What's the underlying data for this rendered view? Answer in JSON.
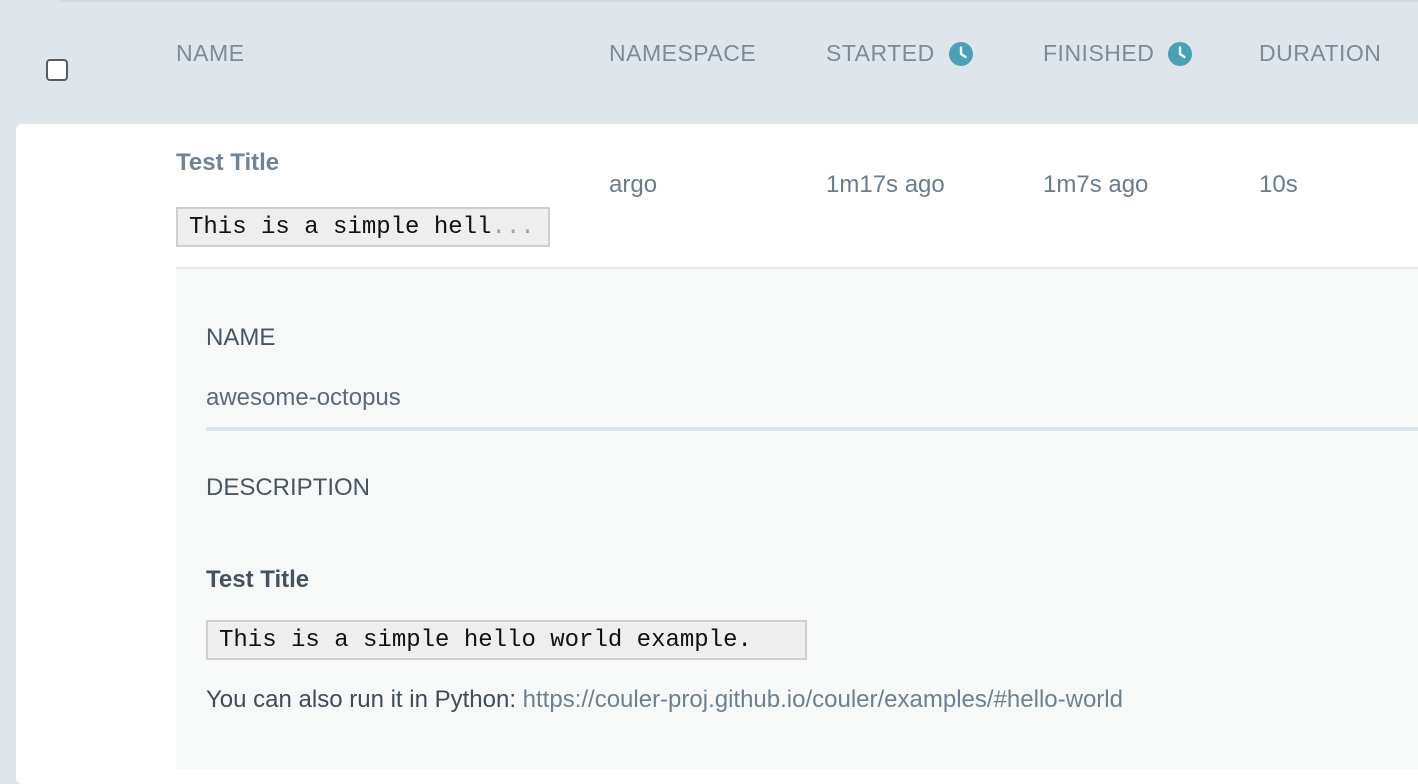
{
  "header": {
    "columns": {
      "name": "NAME",
      "namespace": "NAMESPACE",
      "started": "STARTED",
      "finished": "FINISHED",
      "duration": "DURATION"
    },
    "accent_color": "#4aa0b4"
  },
  "row": {
    "title": "Test Title",
    "code_preview": "This is a simple hell",
    "code_ellipsis": "...",
    "namespace": "argo",
    "started": "1m17s ago",
    "finished": "1m7s ago",
    "duration": "10s"
  },
  "details": {
    "name_label": "NAME",
    "name_value": "awesome-octopus",
    "description_label": "DESCRIPTION",
    "description": {
      "title": "Test Title",
      "code": "This is a simple hello world example.",
      "text_prefix": "You can also run it in Python: ",
      "link": "https://couler-proj.github.io/couler/examples/#hello-world"
    }
  }
}
